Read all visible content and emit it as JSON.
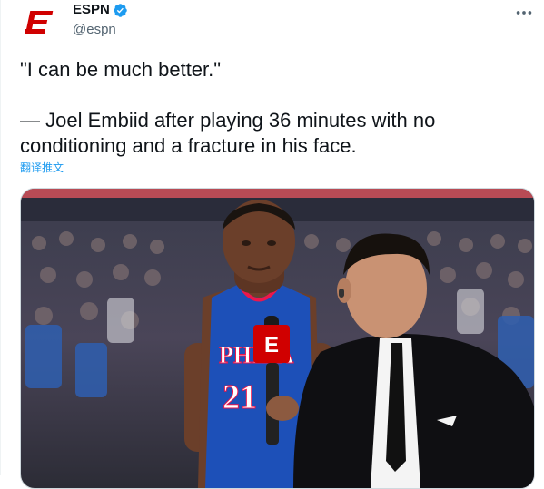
{
  "tweet": {
    "author": {
      "name": "ESPN",
      "handle": "@espn",
      "verified": true,
      "logo_letter": "E",
      "brand_color": "#d00000"
    },
    "text": "\"I can be much better.\"\n\n— Joel Embiid after playing 36 minutes with no conditioning and a fracture in his face.",
    "translate_label": "翻译推文",
    "media": {
      "jersey_wordmark": "PHILA",
      "jersey_number": "21",
      "mic_flag_letter": "E"
    }
  },
  "icons": {
    "verified": "verified-badge-icon",
    "more": "more-horizontal-icon"
  },
  "colors": {
    "text_primary": "#0f1419",
    "text_secondary": "#536471",
    "link": "#1d9bf0",
    "verified": "#1d9bf0",
    "jersey_blue": "#1d50b8",
    "jersey_red": "#ed174c"
  }
}
